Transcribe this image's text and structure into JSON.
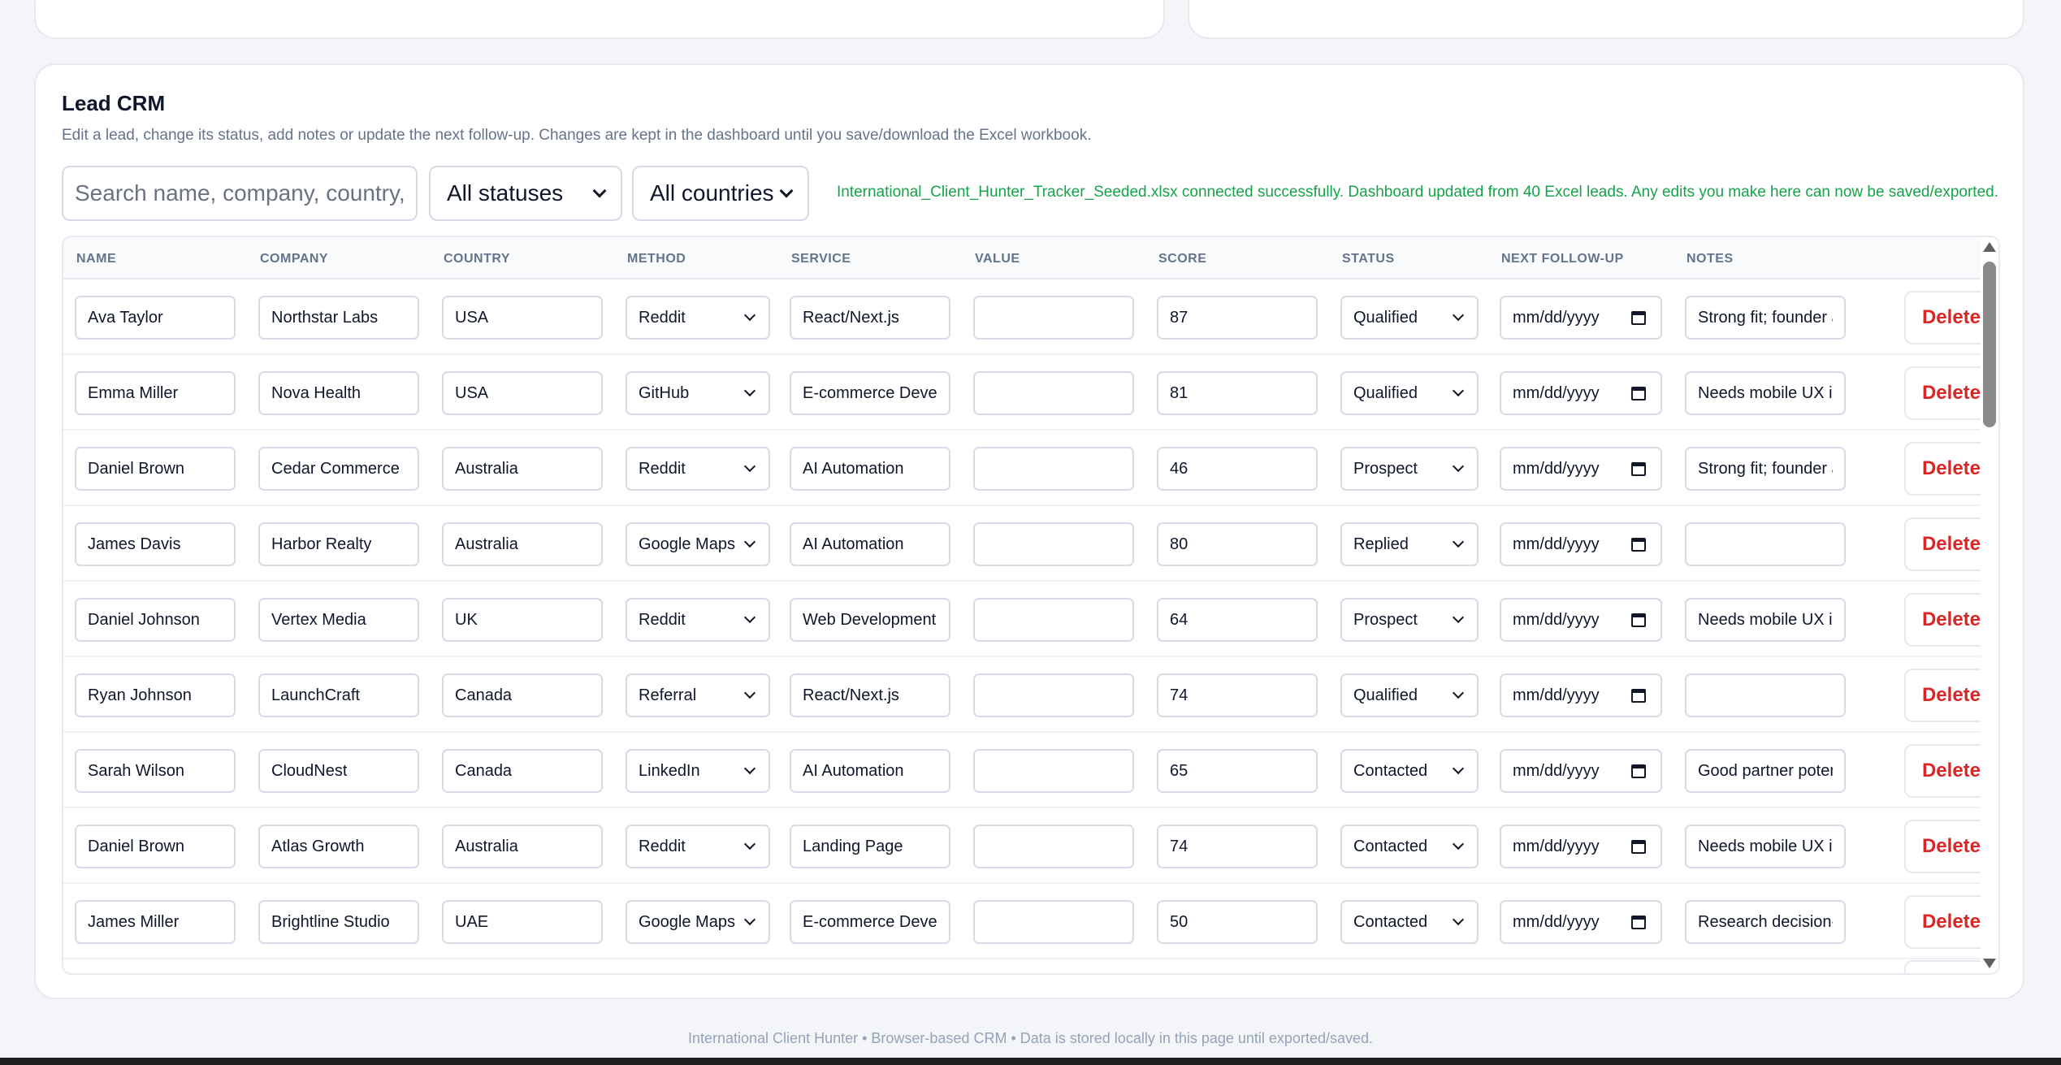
{
  "crm": {
    "title": "Lead CRM",
    "subtitle": "Edit a lead, change its status, add notes or update the next follow-up. Changes are kept in the dashboard until you save/download the Excel workbook.",
    "search_placeholder": "Search name, company, country, service...",
    "status_filter": "All statuses",
    "country_filter": "All countries",
    "status_message": "International_Client_Hunter_Tracker_Seeded.xlsx connected successfully. Dashboard updated from 40 Excel leads. Any edits you make here can now be saved/exported."
  },
  "table": {
    "headers": [
      "NAME",
      "COMPANY",
      "COUNTRY",
      "METHOD",
      "SERVICE",
      "VALUE",
      "SCORE",
      "STATUS",
      "NEXT FOLLOW-UP",
      "NOTES"
    ],
    "date_placeholder": "mm/dd/yyyy",
    "delete_label": "Delete",
    "rows": [
      {
        "name": "Ava Taylor",
        "company": "Northstar Labs",
        "country": "USA",
        "method": "Reddit",
        "service": "React/Next.js",
        "value": "",
        "score": "87",
        "status": "Qualified",
        "notes": "Strong fit; founder a"
      },
      {
        "name": "Emma Miller",
        "company": "Nova Health",
        "country": "USA",
        "method": "GitHub",
        "service": "E-commerce Develo",
        "value": "",
        "score": "81",
        "status": "Qualified",
        "notes": "Needs mobile UX im"
      },
      {
        "name": "Daniel Brown",
        "company": "Cedar Commerce",
        "country": "Australia",
        "method": "Reddit",
        "service": "AI Automation",
        "value": "",
        "score": "46",
        "status": "Prospect",
        "notes": "Strong fit; founder a"
      },
      {
        "name": "James Davis",
        "company": "Harbor Realty",
        "country": "Australia",
        "method": "Google Maps",
        "service": "AI Automation",
        "value": "",
        "score": "80",
        "status": "Replied",
        "notes": ""
      },
      {
        "name": "Daniel Johnson",
        "company": "Vertex Media",
        "country": "UK",
        "method": "Reddit",
        "service": "Web Development",
        "value": "",
        "score": "64",
        "status": "Prospect",
        "notes": "Needs mobile UX im"
      },
      {
        "name": "Ryan Johnson",
        "company": "LaunchCraft",
        "country": "Canada",
        "method": "Referral",
        "service": "React/Next.js",
        "value": "",
        "score": "74",
        "status": "Qualified",
        "notes": ""
      },
      {
        "name": "Sarah Wilson",
        "company": "CloudNest",
        "country": "Canada",
        "method": "LinkedIn",
        "service": "AI Automation",
        "value": "",
        "score": "65",
        "status": "Contacted",
        "notes": "Good partner poten"
      },
      {
        "name": "Daniel Brown",
        "company": "Atlas Growth",
        "country": "Australia",
        "method": "Reddit",
        "service": "Landing Page",
        "value": "",
        "score": "74",
        "status": "Contacted",
        "notes": "Needs mobile UX im"
      },
      {
        "name": "James Miller",
        "company": "Brightline Studio",
        "country": "UAE",
        "method": "Google Maps",
        "service": "E-commerce Develo",
        "value": "",
        "score": "50",
        "status": "Contacted",
        "notes": "Research decision-m"
      }
    ]
  },
  "footer": "International Client Hunter • Browser-based CRM • Data is stored locally in this page until exported/saved."
}
